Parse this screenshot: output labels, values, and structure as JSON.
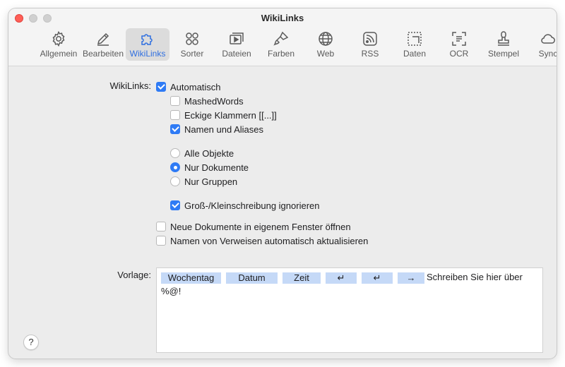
{
  "window": {
    "title": "WikiLinks"
  },
  "toolbar": {
    "items": [
      {
        "label": "Allgemein",
        "icon": "gear-icon"
      },
      {
        "label": "Bearbeiten",
        "icon": "pencil-icon"
      },
      {
        "label": "WikiLinks",
        "icon": "puzzle-icon",
        "active": true
      },
      {
        "label": "Sorter",
        "icon": "circles-icon"
      },
      {
        "label": "Dateien",
        "icon": "files-icon"
      },
      {
        "label": "Farben",
        "icon": "brush-icon"
      },
      {
        "label": "Web",
        "icon": "globe-icon"
      },
      {
        "label": "RSS",
        "icon": "rss-icon"
      },
      {
        "label": "Daten",
        "icon": "data-icon"
      },
      {
        "label": "OCR",
        "icon": "ocr-icon"
      },
      {
        "label": "Stempel",
        "icon": "stamp-icon"
      },
      {
        "label": "Sync",
        "icon": "cloud-icon"
      }
    ]
  },
  "settings": {
    "wikilinks_label": "WikiLinks:",
    "automatisch": {
      "label": "Automatisch",
      "checked": true
    },
    "mashedwords": {
      "label": "MashedWords",
      "checked": false
    },
    "eckige": {
      "label": "Eckige Klammern [[...]]",
      "checked": false
    },
    "namen_aliases": {
      "label": "Namen und Aliases",
      "checked": true
    },
    "scope": {
      "options": [
        "Alle Objekte",
        "Nur Dokumente",
        "Nur Gruppen"
      ],
      "selected": "Nur Dokumente"
    },
    "case_ignore": {
      "label": "Groß-/Kleinschreibung ignorieren",
      "checked": true
    },
    "new_window": {
      "label": "Neue Dokumente in eigenem Fenster öffnen",
      "checked": false
    },
    "update_names": {
      "label": "Namen von Verweisen automatisch aktualisieren",
      "checked": false
    },
    "vorlage_label": "Vorlage:",
    "template": {
      "tokens": [
        "Wochentag",
        "Datum",
        "Zeit",
        "↵",
        "↵",
        "→"
      ],
      "text": "Schreiben Sie hier über %@!"
    }
  },
  "help": {
    "label": "?"
  },
  "colors": {
    "accent": "#2f7bf5",
    "token_bg": "#c5d9f7",
    "close": "#ff5f57"
  }
}
